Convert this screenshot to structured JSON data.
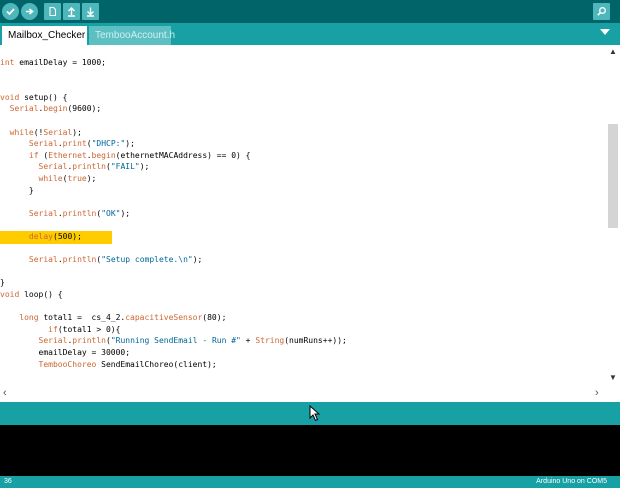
{
  "toolbar": {
    "buttons": [
      {
        "name": "verify-button",
        "icon": "checkmark-icon"
      },
      {
        "name": "upload-button",
        "icon": "arrow-right-icon"
      },
      {
        "name": "new-button",
        "icon": "new-file-icon"
      },
      {
        "name": "open-button",
        "icon": "arrow-up-icon"
      },
      {
        "name": "save-button",
        "icon": "arrow-down-icon"
      }
    ],
    "serial_monitor_icon": "magnifier-icon"
  },
  "tabs": [
    {
      "label": "Mailbox_Checker §",
      "active": true
    },
    {
      "label": "TembooAccount.h",
      "active": false
    }
  ],
  "editor": {
    "lines": [
      "int emailDelay = 1000;",
      "",
      "",
      "void setup() {",
      "  Serial.begin(9600);",
      "",
      "  while(!Serial);",
      "      Serial.print(\"DHCP:\");",
      "      if (Ethernet.begin(ethernetMACAddress) == 0) {",
      "        Serial.println(\"FAIL\");",
      "        while(true);",
      "      }",
      "",
      "      Serial.println(\"OK\");",
      "",
      "      delay(500);",
      "",
      "      Serial.println(\"Setup complete.\\n\");",
      "",
      "}",
      "void loop() {",
      "",
      "    long total1 =  cs_4_2.capacitiveSensor(80);",
      "          if(total1 > 0){",
      "        Serial.println(\"Running SendEmail - Run #\" + String(numRuns++));",
      "        emailDelay = 30000;",
      "        TembooChoreo SendEmailChoreo(client);"
    ],
    "highlighted_line": 15
  },
  "status": {
    "line_number": "36",
    "board": "Arduino Uno on COM5"
  },
  "colors": {
    "toolbar_bg": "#006468",
    "tabbar_bg": "#17a1a5",
    "button_bg": "#4db7bb",
    "keyword": "#cc6633",
    "string": "#006699",
    "highlight": "#ffcc00",
    "console_bg": "#000000"
  }
}
